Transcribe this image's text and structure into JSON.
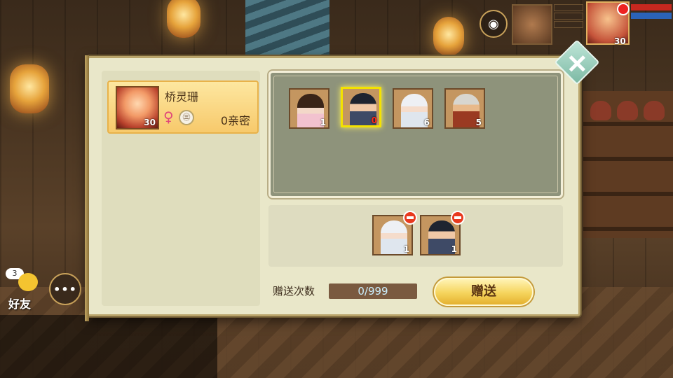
{
  "hud": {
    "player_level": "30",
    "icons": [
      "camera-icon",
      "pet-portrait",
      "player-avatar",
      "notification-dot"
    ]
  },
  "social": {
    "friend_badge_count": "3",
    "friend_label": "好友",
    "chat_button_label": "•••"
  },
  "dialog": {
    "friend": {
      "name": "桥灵珊",
      "level": "30",
      "gender_symbol": "♀",
      "status_icon": "㊂",
      "intimacy": "0亲密"
    },
    "gift_items": [
      {
        "id": "item-1",
        "count": "1",
        "selected": false,
        "figure": "fig-a"
      },
      {
        "id": "item-2",
        "count": "0",
        "selected": true,
        "figure": "fig-b"
      },
      {
        "id": "item-3",
        "count": "6",
        "selected": false,
        "figure": "fig-c"
      },
      {
        "id": "item-4",
        "count": "5",
        "selected": false,
        "figure": "fig-d"
      }
    ],
    "selected_items": [
      {
        "id": "sel-1",
        "count": "1",
        "figure": "fig-c"
      },
      {
        "id": "sel-2",
        "count": "1",
        "figure": "fig-b"
      }
    ],
    "send_count_label": "赠送次数",
    "send_count_value": "0/999",
    "send_button_label": "赠送"
  },
  "colors": {
    "dialog_bg": "#e9e7c9",
    "gift_panel_bg": "#8e937b",
    "send_button": "#f5d45c",
    "selected_highlight": "#f4e200",
    "zero_count": "#ff2a1a"
  }
}
